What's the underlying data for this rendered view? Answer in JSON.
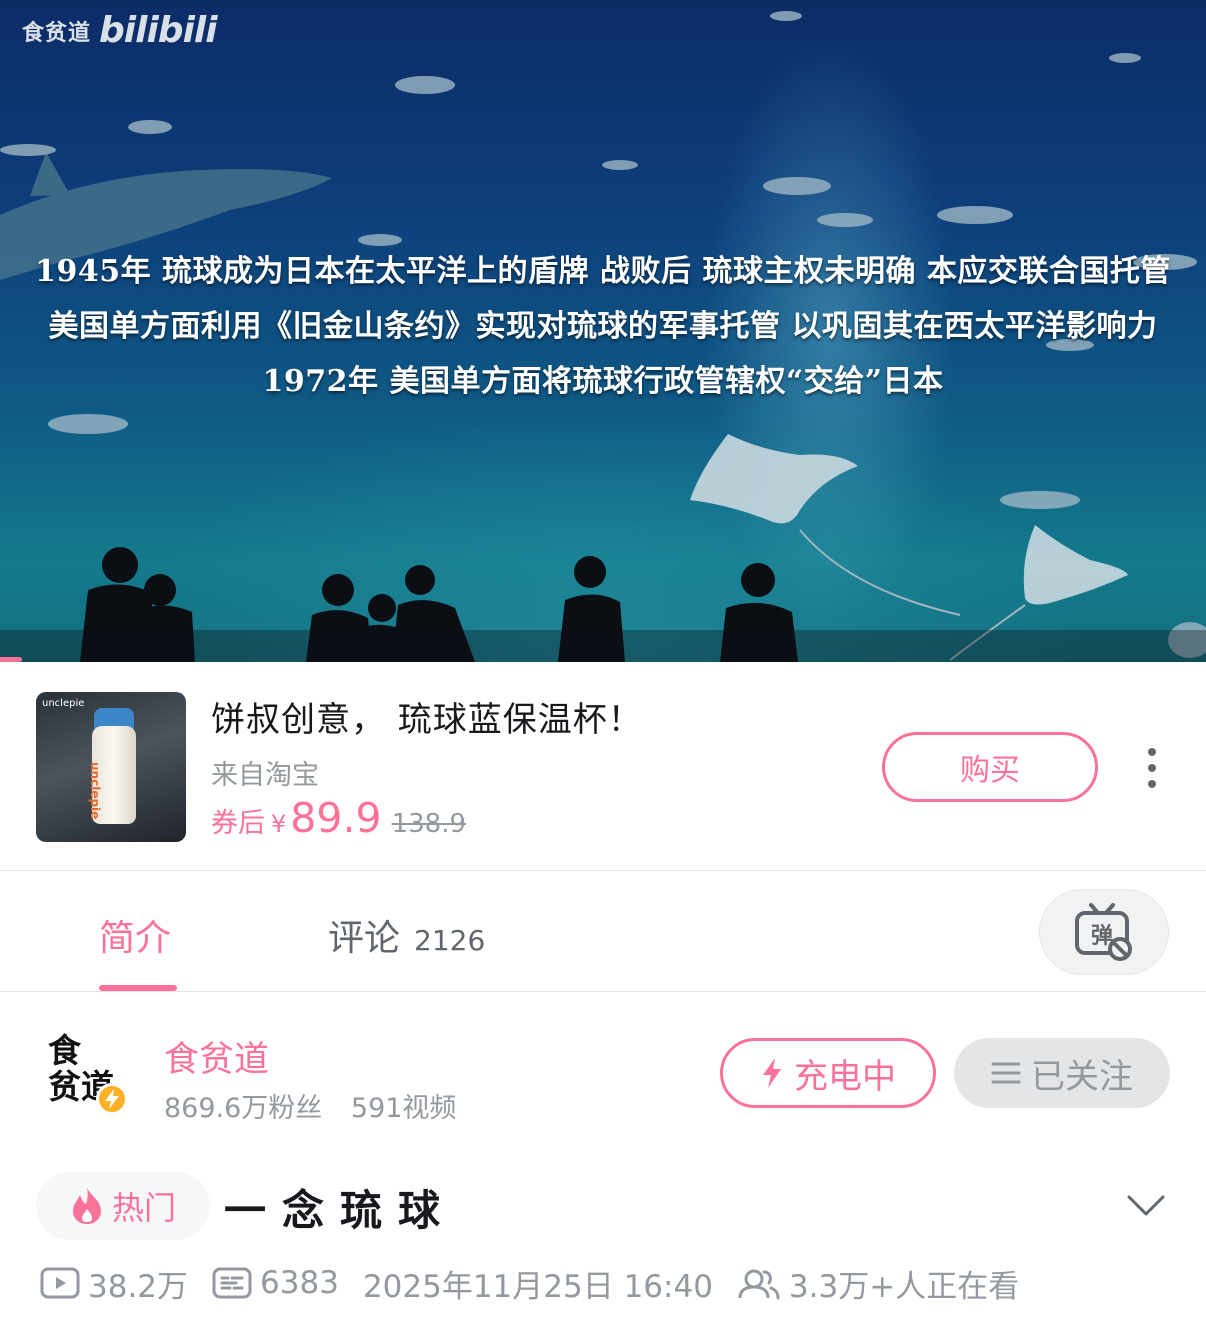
{
  "player": {
    "watermark_text": "食贫道",
    "watermark_logo": "bilibili",
    "subtitles": [
      "1945年 琉球成为日本在太平洋上的盾牌 战败后 琉球主权未明确 本应交联合国托管",
      "美国单方面利用《旧金山条约》实现对琉球的军事托管 以巩固其在西太平洋影响力",
      "1972年 美国单方面将琉球行政管辖权“交给”日本"
    ]
  },
  "ad": {
    "thumb_brand": "unclepie",
    "title": "饼叔创意， 琉球蓝保温杯！",
    "source": "来自淘宝",
    "price_prefix": "券后",
    "currency": "¥",
    "price": "89.9",
    "original_price": "138.9",
    "buy_label": "购买"
  },
  "tabs": {
    "intro_label": "简介",
    "comments_label": "评论",
    "comments_count": "2126"
  },
  "uploader": {
    "avatar_text": "食\n贫道",
    "name": "食贫道",
    "fans": "869.6万粉丝",
    "videos": "591视频",
    "charge_label": "充电中",
    "follow_label": "已关注"
  },
  "video": {
    "hot_label": "热门",
    "title": "一念琉球",
    "views": "38.2万",
    "danmaku_count": "6383",
    "publish_time": "2025年11月25日 16:40",
    "watching": "3.3万+人正在看"
  },
  "colors": {
    "accent": "#fb7299",
    "text_secondary": "#9499a0",
    "charge_icon": "#fb7299",
    "avatar_badge": "#ffb027"
  },
  "icons": [
    "watermark-logo",
    "more-vertical-icon",
    "danmaku-off-icon",
    "lightning-icon",
    "menu-lines-icon",
    "fire-icon",
    "chevron-down-icon",
    "play-count-icon",
    "danmaku-count-icon",
    "viewers-icon"
  ]
}
